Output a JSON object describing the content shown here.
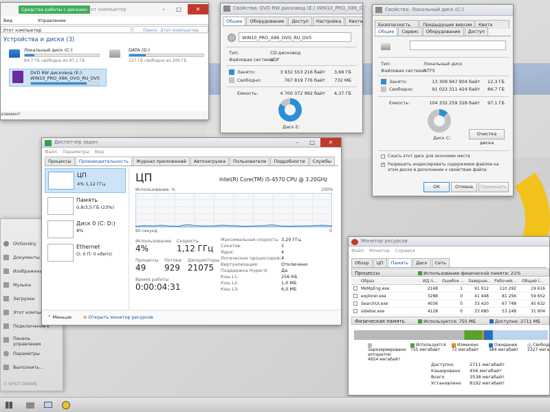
{
  "explorer": {
    "ribbon_tab_active": "Средства работы с дисками",
    "title": "Этот компьютер",
    "menu": [
      "Вид",
      "Управление"
    ],
    "address": "Этот компьютер",
    "search_placeholder": "Поиск: Этот компьютер",
    "section": "Устройства и диски (3)",
    "drives": [
      {
        "name": "Локальный диск (C:)",
        "info": "84,7 ГБ свободно из 97,1 ГБ",
        "used": 0.13
      },
      {
        "name": "DATA (D:)",
        "info": "157 ГБ свободно из 200 ГБ",
        "used": 0.22
      },
      {
        "name": "DVD RW дисковод (E:)",
        "info": "WIN10_PRO_X86_OVG_RU_DV5",
        "used": 0.83
      }
    ],
    "status": "элемент"
  },
  "props_dvd": {
    "title": "Свойства: DVD RW дисковод (E:) WIN10_PRO_X86_OVG...",
    "tabs": [
      "Общие",
      "Оборудование",
      "Доступ",
      "Настройка",
      "Квота"
    ],
    "label_value": "WIN10_PRO_X86_OVG_RU_DV5",
    "type_label": "Тип:",
    "type_value": "CD-дисковод",
    "fs_label": "Файловая система:",
    "fs_value": "UDF",
    "used_label": "Занято:",
    "used_bytes": "3 932 553 216 байт",
    "used_gb": "3,66 ГБ",
    "free_label": "Свободно:",
    "free_bytes": "767 819 776 байт",
    "free_gb": "732 МБ",
    "cap_label": "Емкость:",
    "cap_bytes": "4 700 372 992 байт",
    "cap_gb": "4,37 ГБ",
    "disk_label": "Диск E:",
    "used_fraction": 0.837
  },
  "props_c": {
    "title": "Свойства: Локальный диск (C:)",
    "tabs_top": [
      "Безопасность",
      "Предыдущие версии",
      "Квота"
    ],
    "tabs_bottom": [
      "Общие",
      "Сервис",
      "Оборудование",
      "Доступ"
    ],
    "type_label": "Тип:",
    "type_value": "Локальный диск",
    "fs_label": "Файловая система:",
    "fs_value": "NTFS",
    "used_label": "Занято:",
    "used_bytes": "13 309 947 904 байт",
    "used_gb": "12,3 ГБ",
    "free_label": "Свободно:",
    "free_bytes": "91 022 311 424 байт",
    "free_gb": "84,7 ГБ",
    "cap_label": "Емкость:",
    "cap_bytes": "104 332 259 328 байт",
    "cap_gb": "97,1 ГБ",
    "disk_label": "Диск C:",
    "cleanup": "Очистка диска",
    "compress": "Сжать этот диск для экономии места",
    "index": "Разрешить индексировать содержимое файлов на этом диске в дополнение к свойствам файла",
    "ok": "ОК",
    "cancel": "Отмена",
    "apply": "Применить",
    "used_fraction": 0.128
  },
  "taskmgr": {
    "title": "Диспетчер задач",
    "menu": [
      "Файл",
      "Параметры",
      "Вид"
    ],
    "tabs": [
      "Процессы",
      "Производительность",
      "Журнал приложений",
      "Автозагрузка",
      "Пользователи",
      "Подробности",
      "Службы"
    ],
    "side": [
      {
        "name": "ЦП",
        "sub": "4% 1,12 ГГц"
      },
      {
        "name": "Память",
        "sub": "0,8/3,5 ГБ (23%)"
      },
      {
        "name": "Диск 0 (C: D:)",
        "sub": "8%"
      },
      {
        "name": "Ethernet",
        "sub": "О: 0 П: 0 кбит/с"
      }
    ],
    "cpu_title": "ЦП",
    "cpu_model": "Intel(R) Core(TM) i5-4570 CPU @ 3.20GHz",
    "graph_label": "Использование, %",
    "graph_max": "100%",
    "graph_time": "60 секунд",
    "graph_min": "0",
    "usage_label": "Использование",
    "usage": "4%",
    "speed_label": "Скорость",
    "speed": "1,12 ГГц",
    "proc_label": "Процессы",
    "proc": "49",
    "threads_label": "Потоки",
    "threads": "929",
    "handles_label": "Дескрипторы",
    "handles": "21075",
    "uptime_label": "Время работы",
    "uptime": "0:00:04:31",
    "specs": [
      {
        "k": "Максимальная скорость:",
        "v": "3,20 ГГц"
      },
      {
        "k": "Сокетов:",
        "v": "1"
      },
      {
        "k": "Ядра:",
        "v": "4"
      },
      {
        "k": "Логических процессоров:",
        "v": "4"
      },
      {
        "k": "Виртуализация:",
        "v": "Отключено"
      },
      {
        "k": "Поддержка Hyper-V:",
        "v": "Да"
      },
      {
        "k": "Кэш L1:",
        "v": "256 КБ"
      },
      {
        "k": "Кэш L2:",
        "v": "1,0 МБ"
      },
      {
        "k": "Кэш L3:",
        "v": "6,0 МБ"
      }
    ],
    "less": "Меньше",
    "open_monitor": "Открыть монитор ресурсов",
    "cpu_history": [
      3,
      5,
      4,
      6,
      4,
      3,
      8,
      5,
      4,
      4,
      6,
      5,
      4,
      3,
      4,
      5,
      7,
      4,
      3,
      4,
      4,
      5,
      6,
      4
    ]
  },
  "resmon": {
    "title": "Монитор ресурсов",
    "menu": [
      "Файл",
      "Монитор",
      "Справка"
    ],
    "tabs": [
      "Обзор",
      "ЦП",
      "Память",
      "Диск",
      "Сеть"
    ],
    "processes_label": "Процессы",
    "phys_header": "Использование физической памяти: 21%",
    "columns": [
      "Образ",
      "ИД п...",
      "Ошибок ...",
      "Заверше...",
      "Рабочий...",
      "Общий (..."
    ],
    "rows": [
      [
        "MsMpEng.exe",
        "2148",
        "1",
        "91 912",
        "110 292",
        "19 616"
      ],
      [
        "explorer.exe",
        "3288",
        "0",
        "41 448",
        "81 256",
        "59 652"
      ],
      [
        "SearchUI.exe",
        "4036",
        "0",
        "33 420",
        "67 748",
        "45 632"
      ],
      [
        "sidebar.exe",
        "4128",
        "0",
        "33 680",
        "53 248",
        "31 904"
      ]
    ],
    "phys_label": "Физическая память",
    "in_use_header": "Используется: 755 МБ",
    "avail_header": "Доступно: 2711 МБ",
    "legend": [
      {
        "name": "Зарезервировано аппаратно",
        "value": "4654 мегабайт",
        "color": "#b8b8b8"
      },
      {
        "name": "Используется",
        "value": "755 мегабайт",
        "color": "#5aa02c"
      },
      {
        "name": "Изменено",
        "value": "72 мегабайт",
        "color": "#e08a1e"
      },
      {
        "name": "Ожидание",
        "value": "384 мегабайт",
        "color": "#1f6fc0"
      },
      {
        "name": "Свободно",
        "value": "2327 мегабайт",
        "color": "#bcd4ee"
      }
    ],
    "summary": [
      {
        "k": "Доступно",
        "v": "2711 мегабайт"
      },
      {
        "k": "Кэшировано",
        "v": "456 мегабайт"
      },
      {
        "k": "Всего",
        "v": "3538 мегабайт"
      },
      {
        "k": "Установлено",
        "v": "8192 мегабайт"
      }
    ]
  },
  "startmenu": {
    "user": "OVGorskiy",
    "items": [
      "Документы",
      "Изображения",
      "Музыка",
      "Загрузки",
      "Этот компьютер",
      "Подключение к",
      "Панель управления",
      "Параметры",
      "Выполнить..."
    ],
    "shutdown": "SHUT DOWN"
  },
  "colors": {
    "accent": "#2c8fd6",
    "used": "#2c8fd6",
    "free": "#c3c3c3",
    "close": "#c0392b"
  }
}
